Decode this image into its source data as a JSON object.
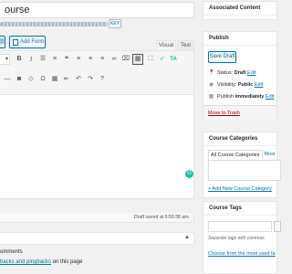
{
  "title_field": {
    "value": "ourse"
  },
  "permalink": {
    "button_label": "KEY"
  },
  "editor": {
    "add_form_label": "Add Form",
    "tab_visual": "Visual",
    "tab_text": "Text",
    "toolbar_row1": [
      {
        "name": "paragraph-select",
        "glyph": "▾"
      },
      {
        "name": "bold-icon",
        "glyph": "B"
      },
      {
        "name": "italic-icon",
        "glyph": "I"
      },
      {
        "name": "bullet-list-icon",
        "glyph": "☰"
      },
      {
        "name": "numbered-list-icon",
        "glyph": "≡"
      },
      {
        "name": "blockquote-icon",
        "glyph": "❝"
      },
      {
        "name": "align-left-icon",
        "glyph": "≡"
      },
      {
        "name": "align-center-icon",
        "glyph": "≡"
      },
      {
        "name": "align-right-icon",
        "glyph": "≡"
      },
      {
        "name": "link-icon",
        "glyph": "🔗"
      },
      {
        "name": "unlink-icon",
        "glyph": "⌧"
      },
      {
        "name": "toolbar-toggle-icon",
        "glyph": "▦"
      },
      {
        "name": "fullscreen-icon",
        "glyph": "⛶"
      },
      {
        "name": "grammarly-check-icon",
        "glyph": "✓"
      },
      {
        "name": "text-assistant-icon",
        "glyph": "TA"
      }
    ],
    "toolbar_row2": [
      {
        "name": "strikethrough-icon",
        "glyph": "—"
      },
      {
        "name": "horizontal-rule-icon",
        "glyph": "―"
      },
      {
        "name": "text-color-icon",
        "glyph": "A"
      },
      {
        "name": "paste-text-icon",
        "glyph": "▣"
      },
      {
        "name": "clear-formatting-icon",
        "glyph": "◇"
      },
      {
        "name": "special-char-icon",
        "glyph": "Ω"
      },
      {
        "name": "outdent-icon",
        "glyph": "⇤"
      },
      {
        "name": "indent-icon",
        "glyph": "⇥"
      },
      {
        "name": "undo-icon",
        "glyph": "↶"
      },
      {
        "name": "redo-icon",
        "glyph": "↷"
      },
      {
        "name": "help-icon",
        "glyph": "?"
      }
    ],
    "draft_saved": "Draft saved at 6:50:38 am."
  },
  "comments": {
    "label": "omments",
    "trackbacks_prefix": "",
    "trackbacks_link": "backs and pingbacks",
    "trackbacks_suffix": " on this page"
  },
  "sidebar": {
    "associated_content_title": "Associated Content",
    "publish": {
      "title": "Publish",
      "save_draft": "Save Draft",
      "status_label": "Status: ",
      "status_value": "Draft",
      "visibility_label": "Visibility: ",
      "visibility_value": "Public",
      "publish_label": "Publish ",
      "publish_value": "immediately",
      "edit_link": "Edit",
      "move_to_trash": "Move to Trash"
    },
    "course_categories": {
      "title": "Course Categories",
      "tab_all": "All Course Categories",
      "tab_most": "Most",
      "add_new": "+ Add New Course Category"
    },
    "course_tags": {
      "title": "Course Tags",
      "hint": "Separate tags with commas",
      "choose": "Choose from the most used ta"
    }
  }
}
